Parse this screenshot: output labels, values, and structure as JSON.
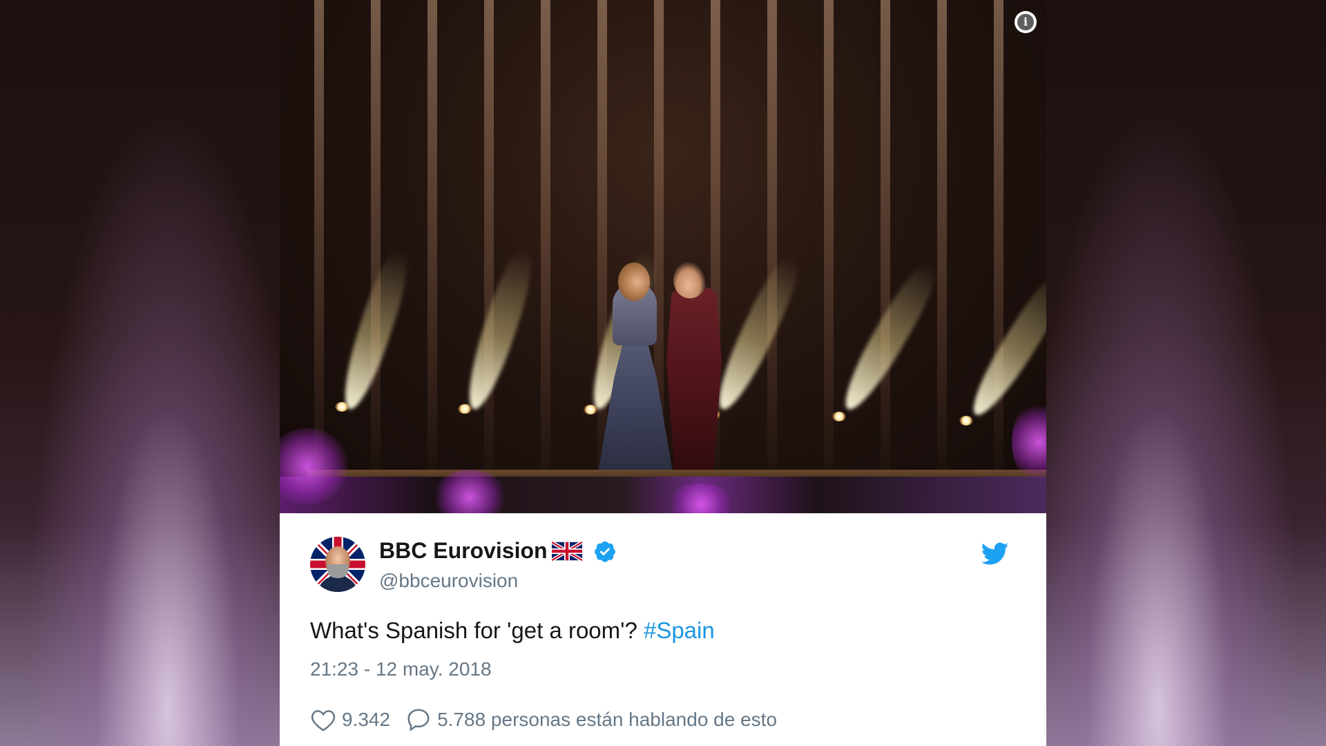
{
  "tweet": {
    "author": {
      "display_name": "BBC Eurovision",
      "handle": "@bbceurovision",
      "flag": "uk-flag",
      "verified": true
    },
    "text_plain": "What's Spanish for 'get a room'? ",
    "hashtag": "#Spain",
    "timestamp": "21:23 - 12 may. 2018",
    "likes": "9.342",
    "conversation": "5.788 personas están hablando de esto"
  },
  "icons": {
    "info": "info-icon",
    "twitter": "twitter-bird-icon",
    "like": "heart-icon",
    "reply": "speech-bubble-icon",
    "verified": "verified-badge-icon"
  },
  "colors": {
    "link": "#1b95e0",
    "secondary_text": "#657786",
    "primary_text": "#14171a",
    "verified": "#1da1f2"
  }
}
